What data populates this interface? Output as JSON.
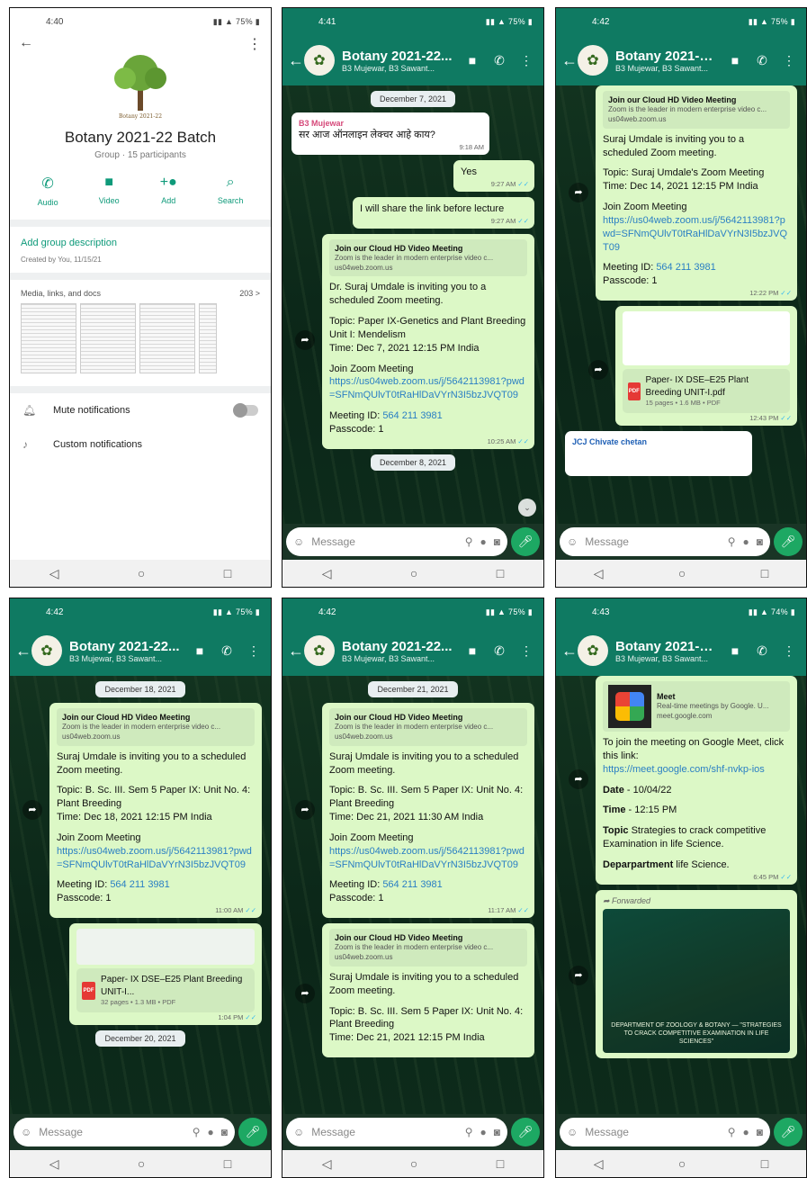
{
  "colors": {
    "header": "#0f7a62",
    "bubble_out": "#dcf8c6",
    "accent": "#0e9a7a"
  },
  "group": {
    "name": "Botany 2021-22 Batch",
    "name_short": "Botany 2021-22...",
    "participants_line": "Group · 15 participants",
    "members": "B3 Mujewar, B3 Sawant...",
    "logo_caption": "Botany 2021-22"
  },
  "message_placeholder": "Message",
  "screens": {
    "s1": {
      "time": "4:40",
      "battery": "75%",
      "actions": [
        "Audio",
        "Video",
        "Add",
        "Search"
      ],
      "add_desc": "Add group description",
      "created": "Created by You, 11/15/21",
      "media_label": "Media, links, and docs",
      "media_count": "203 >",
      "mute": "Mute notifications",
      "custom": "Custom notifications"
    },
    "s2": {
      "time": "4:41",
      "battery": "75%",
      "date1": "December 7, 2021",
      "sender": "B3 Mujewar",
      "hindi": "सर आज ऑनलाइन लेक्चर आहे काय?",
      "hindi_time": "9:18 AM",
      "yes": "Yes",
      "yes_time": "9:27 AM",
      "share": "I will share the link before lecture",
      "share_time": "9:27 AM",
      "prev_title": "Join our Cloud HD Video Meeting",
      "prev_sub": "Zoom is the leader in modern enterprise video c...",
      "prev_url": "us04web.zoom.us",
      "invite": "Dr. Suraj Umdale is inviting you to a scheduled Zoom meeting.",
      "topic": "Topic: Paper IX-Genetics and Plant Breeding Unit I: Mendelism",
      "mtime": "Time: Dec 7, 2021 12:15 PM India",
      "join": "Join Zoom Meeting",
      "link": "https://us04web.zoom.us/j/5642113981?pwd=SFNmQUlvT0tRaHlDaVYrN3I5bzJVQT09",
      "mid_label": "Meeting ID: ",
      "mid": "564 211 3981",
      "pass": "Passcode: 1",
      "ztime": "10:25 AM",
      "date2": "December 8, 2021"
    },
    "s3": {
      "time": "4:42",
      "battery": "75%",
      "invite": "Suraj Umdale is inviting you to a scheduled Zoom meeting.",
      "topic": "Topic: Suraj Umdale's Zoom Meeting",
      "mtime": "Time: Dec 14, 2021 12:15 PM India",
      "ztime": "12:22 PM",
      "pdf_name": "Paper- IX DSE–E25 Plant Breeding UNIT-I.pdf",
      "pdf_meta": "15 pages • 1.6 MB • PDF",
      "pdf_time": "12:43 PM",
      "sender": "JCJ Chivate chetan"
    },
    "s4": {
      "time": "4:42",
      "battery": "75%",
      "date1": "December 18, 2021",
      "topic": "Topic: B. Sc. III. Sem 5 Paper IX: Unit No. 4: Plant Breeding",
      "mtime": "Time: Dec 18, 2021 12:15 PM India",
      "ztime": "11:00 AM",
      "pdf_name": "Paper- IX DSE–E25 Plant Breeding UNIT-I...",
      "pdf_meta": "32 pages • 1.3 MB • PDF",
      "pdf_time": "1:04 PM",
      "date2": "December 20, 2021"
    },
    "s5": {
      "time": "4:42",
      "battery": "75%",
      "date1": "December 21, 2021",
      "mtime": "Time: Dec 21, 2021 11:30 AM India",
      "ztime": "11:17 AM",
      "mtime2": "Time: Dec 21, 2021 12:15 PM India"
    },
    "s6": {
      "time": "4:43",
      "battery": "74%",
      "meet_title": "Meet",
      "meet_sub": "Real-time meetings by Google. U...",
      "meet_url": "meet.google.com",
      "join": "To join the meeting on Google Meet, click this link:",
      "link": "https://meet.google.com/shf-nvkp-ios",
      "date_label": "Date",
      "date": " - 10/04/22",
      "time_label": "Time",
      "time_val": " - 12:15 PM",
      "topic_label": "Topic",
      "topic": " Strategies to crack competitive Examination in life Science.",
      "dept_label": "Deparpartment",
      "dept": " life  Science.",
      "mtime": "6:45 PM",
      "forwarded": "Forwarded",
      "poster_text": "DEPARTMENT OF ZOOLOGY & BOTANY — \"STRATEGIES TO CRACK COMPETITIVE EXAMINATION IN LIFE SCIENCES\""
    }
  }
}
